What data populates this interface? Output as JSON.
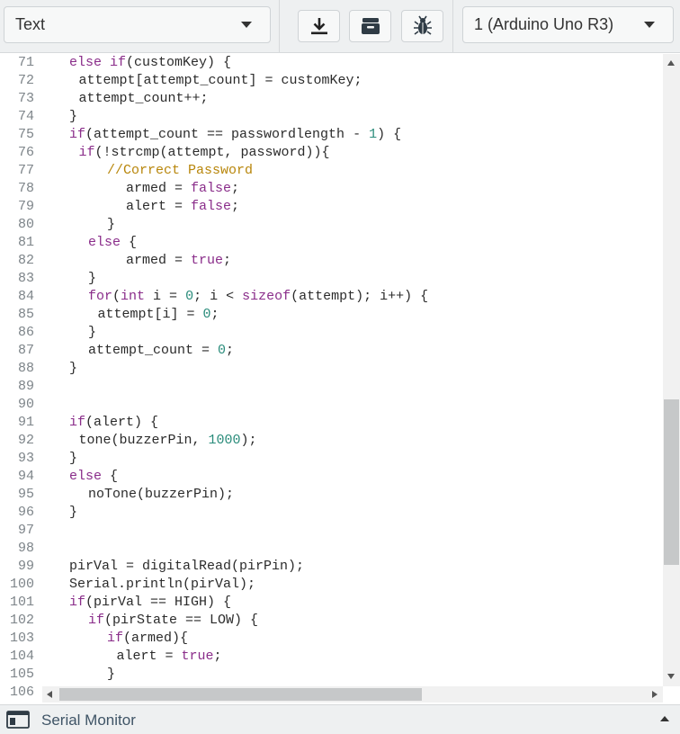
{
  "toolbar": {
    "mode_select": {
      "value": "Text",
      "icon": "chevron-down-icon"
    },
    "buttons": [
      {
        "name": "download-button",
        "icon": "download-icon"
      },
      {
        "name": "libraries-button",
        "icon": "archive-box-icon"
      },
      {
        "name": "debugger-button",
        "icon": "bug-icon"
      }
    ],
    "device_select": {
      "value": "1 (Arduino Uno R3)",
      "icon": "chevron-down-icon"
    }
  },
  "editor": {
    "lines": [
      {
        "n": "71",
        "indent": 2,
        "tokens": [
          [
            "kw",
            "else if"
          ],
          [
            "t",
            "(customKey) {"
          ]
        ]
      },
      {
        "n": "72",
        "indent": 3,
        "tokens": [
          [
            "t",
            "attempt[attempt_count] = customKey;"
          ]
        ]
      },
      {
        "n": "73",
        "indent": 3,
        "tokens": [
          [
            "t",
            "attempt_count++;"
          ]
        ]
      },
      {
        "n": "74",
        "indent": 2,
        "tokens": [
          [
            "t",
            "}"
          ]
        ]
      },
      {
        "n": "75",
        "indent": 2,
        "tokens": [
          [
            "kw",
            "if"
          ],
          [
            "t",
            "(attempt_count == passwordlength - "
          ],
          [
            "num",
            "1"
          ],
          [
            "t",
            ") {"
          ]
        ]
      },
      {
        "n": "76",
        "indent": 3,
        "tokens": [
          [
            "kw",
            "if"
          ],
          [
            "t",
            "(!strcmp(attempt, password)){"
          ]
        ]
      },
      {
        "n": "77",
        "indent": 6,
        "tokens": [
          [
            "cm",
            "//Correct Password"
          ]
        ]
      },
      {
        "n": "78",
        "indent": 8,
        "tokens": [
          [
            "t",
            "armed = "
          ],
          [
            "kw",
            "false"
          ],
          [
            "t",
            ";"
          ]
        ]
      },
      {
        "n": "79",
        "indent": 8,
        "tokens": [
          [
            "t",
            "alert = "
          ],
          [
            "kw",
            "false"
          ],
          [
            "t",
            ";"
          ]
        ]
      },
      {
        "n": "80",
        "indent": 6,
        "tokens": [
          [
            "t",
            "}"
          ]
        ]
      },
      {
        "n": "81",
        "indent": 4,
        "tokens": [
          [
            "kw",
            "else"
          ],
          [
            "t",
            " {"
          ]
        ]
      },
      {
        "n": "82",
        "indent": 8,
        "tokens": [
          [
            "t",
            "armed = "
          ],
          [
            "kw",
            "true"
          ],
          [
            "t",
            ";"
          ]
        ]
      },
      {
        "n": "83",
        "indent": 4,
        "tokens": [
          [
            "t",
            "}"
          ]
        ]
      },
      {
        "n": "84",
        "indent": 4,
        "tokens": [
          [
            "kw",
            "for"
          ],
          [
            "t",
            "("
          ],
          [
            "kw",
            "int"
          ],
          [
            "t",
            " i = "
          ],
          [
            "num",
            "0"
          ],
          [
            "t",
            "; i < "
          ],
          [
            "kw",
            "sizeof"
          ],
          [
            "t",
            "(attempt); i++) {"
          ]
        ]
      },
      {
        "n": "85",
        "indent": 5,
        "tokens": [
          [
            "t",
            "attempt[i] = "
          ],
          [
            "num",
            "0"
          ],
          [
            "t",
            ";"
          ]
        ]
      },
      {
        "n": "86",
        "indent": 4,
        "tokens": [
          [
            "t",
            "}"
          ]
        ]
      },
      {
        "n": "87",
        "indent": 4,
        "tokens": [
          [
            "t",
            "attempt_count = "
          ],
          [
            "num",
            "0"
          ],
          [
            "t",
            ";"
          ]
        ]
      },
      {
        "n": "88",
        "indent": 2,
        "tokens": [
          [
            "t",
            "}"
          ]
        ]
      },
      {
        "n": "89",
        "indent": 0,
        "tokens": []
      },
      {
        "n": "90",
        "indent": 0,
        "tokens": []
      },
      {
        "n": "91",
        "indent": 2,
        "tokens": [
          [
            "kw",
            "if"
          ],
          [
            "t",
            "(alert) {"
          ]
        ]
      },
      {
        "n": "92",
        "indent": 3,
        "tokens": [
          [
            "t",
            "tone(buzzerPin, "
          ],
          [
            "num",
            "1000"
          ],
          [
            "t",
            ");"
          ]
        ]
      },
      {
        "n": "93",
        "indent": 2,
        "tokens": [
          [
            "t",
            "}"
          ]
        ]
      },
      {
        "n": "94",
        "indent": 2,
        "tokens": [
          [
            "kw",
            "else"
          ],
          [
            "t",
            " {"
          ]
        ]
      },
      {
        "n": "95",
        "indent": 4,
        "tokens": [
          [
            "t",
            "noTone(buzzerPin);"
          ]
        ]
      },
      {
        "n": "96",
        "indent": 2,
        "tokens": [
          [
            "t",
            "}"
          ]
        ]
      },
      {
        "n": "97",
        "indent": 0,
        "tokens": []
      },
      {
        "n": "98",
        "indent": 0,
        "tokens": []
      },
      {
        "n": "99",
        "indent": 2,
        "tokens": [
          [
            "t",
            "pirVal = digitalRead(pirPin);"
          ]
        ]
      },
      {
        "n": "100",
        "indent": 2,
        "tokens": [
          [
            "t",
            "Serial.println(pirVal);"
          ]
        ]
      },
      {
        "n": "101",
        "indent": 2,
        "tokens": [
          [
            "kw",
            "if"
          ],
          [
            "t",
            "(pirVal == HIGH) {"
          ]
        ]
      },
      {
        "n": "102",
        "indent": 4,
        "tokens": [
          [
            "kw",
            "if"
          ],
          [
            "t",
            "(pirState == LOW) {"
          ]
        ]
      },
      {
        "n": "103",
        "indent": 6,
        "tokens": [
          [
            "kw",
            "if"
          ],
          [
            "t",
            "(armed){"
          ]
        ]
      },
      {
        "n": "104",
        "indent": 7,
        "tokens": [
          [
            "t",
            "alert = "
          ],
          [
            "kw",
            "true"
          ],
          [
            "t",
            ";"
          ]
        ]
      },
      {
        "n": "105",
        "indent": 6,
        "tokens": [
          [
            "t",
            "}"
          ]
        ]
      }
    ],
    "partial_line_number": "106"
  },
  "footer": {
    "label": "Serial Monitor",
    "icon": "terminal-window-icon",
    "toggle_icon": "chevron-up-icon"
  },
  "colors": {
    "keyword": "#8a2d8a",
    "number": "#2a8c7b",
    "comment": "#b8860b",
    "text": "#2b2b2b",
    "line_number": "#7d8489"
  }
}
